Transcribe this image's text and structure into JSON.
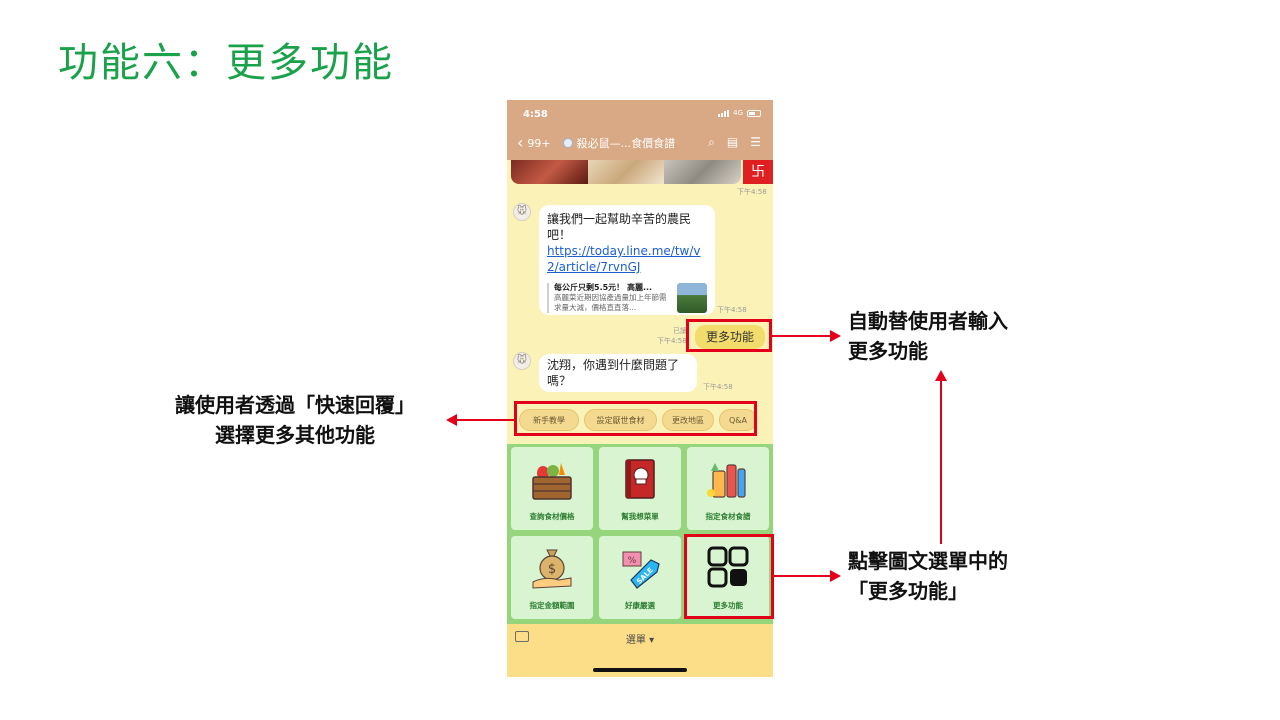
{
  "slide": {
    "title": "功能六：更多功能"
  },
  "status": {
    "time": "4:58",
    "network": "4G"
  },
  "nav": {
    "back_count": "99+",
    "chat_title": "殺必鼠—...食價食譜"
  },
  "chat": {
    "ts_photo": "下午4:58",
    "message1": {
      "text": "讓我們一起幫助辛苦的農民吧！",
      "link": "https://today.line.me/tw/v2/article/7rvnGJ",
      "preview_title": "每公斤只剩5.5元！ 高麗...",
      "preview_desc": "高麗菜近期因協產過量加上年節需求量大減，價格直直落...",
      "time": "下午4:58"
    },
    "sent": {
      "text": "更多功能",
      "read": "已讀",
      "time": "下午4:58"
    },
    "message2": {
      "text": "沈翔，你遇到什麼問題了嗎？",
      "time": "下午4:58"
    }
  },
  "quick_replies": [
    "新手教學",
    "設定厭世食材",
    "更改地區",
    "Q&A"
  ],
  "rich_menu": [
    {
      "label": "查詢食材價格",
      "icon": "vegetable-crate-icon"
    },
    {
      "label": "幫我想菜單",
      "icon": "recipe-book-icon"
    },
    {
      "label": "指定食材食譜",
      "icon": "groceries-icon"
    },
    {
      "label": "指定金額範圍",
      "icon": "money-bag-icon"
    },
    {
      "label": "好康嚴選",
      "icon": "sale-tag-icon"
    },
    {
      "label": "更多功能",
      "icon": "grid-icon"
    }
  ],
  "bottom": {
    "menu_label": "選單 ▾"
  },
  "annotations": {
    "right_top": [
      "自動替使用者輸入",
      "更多功能"
    ],
    "left_mid": [
      "讓使用者透過「快速回覆」",
      "選擇更多其他功能"
    ],
    "right_bottom": [
      "點擊圖文選單中的",
      "「更多功能」"
    ]
  },
  "colors": {
    "title_green": "#1aa24b",
    "header_brown": "#d9a985",
    "chat_bg": "#fbf2b7",
    "menu_green": "#97d57c",
    "highlight_red": "#e3001b"
  }
}
